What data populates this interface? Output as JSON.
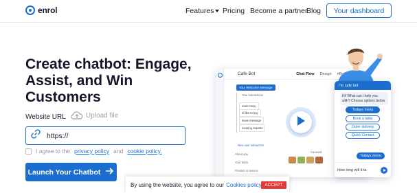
{
  "nav": {
    "logo_text": "enrol",
    "links": [
      "Features",
      "Pricing",
      "Become a partner",
      "Blog"
    ],
    "dashboard_button": "Your dashboard"
  },
  "hero": {
    "title": "Create chatbot: Engage, Assist, and Win Customers",
    "website_url_label": "Website URL",
    "upload_label": "Upload file",
    "url_value": "https://",
    "agree_prefix": "I agree to the",
    "privacy_policy": "privacy policy",
    "and": "and",
    "cookie_policy": "cookie policy.",
    "launch_button": "Launch Your Chatbot"
  },
  "mock": {
    "bot_name": "Cafe Bot",
    "tabs": [
      "Chat Flow",
      "Design",
      "#Botbuilt"
    ],
    "flow_start": "Your Welcome Message",
    "flow_sub": "Your interactions",
    "flow_nodes": [
      "main menu",
      "Id like to buy",
      "leave message",
      "meeting request"
    ],
    "new_interaction": "New user interaction",
    "side_items": [
      "About you",
      "Your team",
      "Product or service"
    ],
    "carousel": "Carousel"
  },
  "chat": {
    "header": "I'm cafe bot",
    "bot_message": "Hi! What can I help you with? Choose options below",
    "options": [
      "Todays menu",
      "Book a table",
      "Order delivery",
      "Quick Contact"
    ],
    "user_message": "Todays menu",
    "input_text": "How long will it ta"
  },
  "cookie": {
    "text": "By using the website, you agree to our",
    "link": "Cookies policy.",
    "accept": "ACCEPT"
  },
  "colors": {
    "accent": "#1c6dd0",
    "accept": "#e23b3b"
  }
}
